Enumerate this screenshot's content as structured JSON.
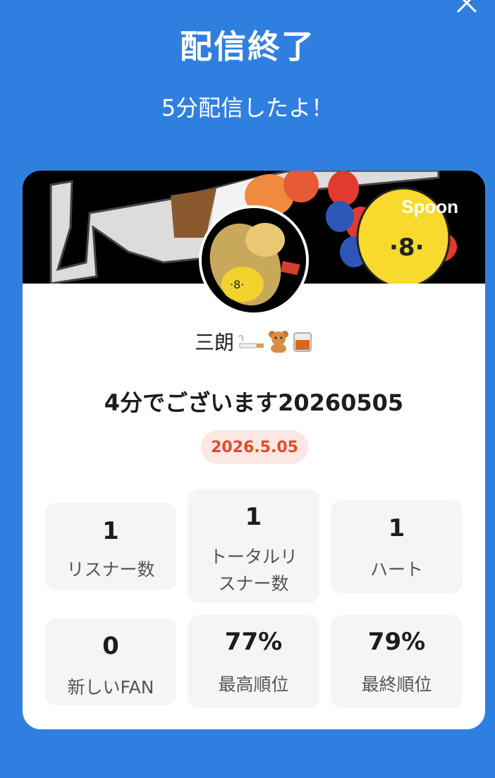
{
  "header": {
    "title": "配信終了",
    "subtitle": "5分配信したよ！"
  },
  "icons": {
    "close": "close-icon"
  },
  "card": {
    "brand": "Spoon",
    "username": "三朗",
    "username_emojis": [
      "cigarette-icon",
      "teddy-bear-icon",
      "whiskey-glass-icon"
    ],
    "live_title": "4分でございます20260505",
    "date": "2026.5.05"
  },
  "stats": {
    "listeners": {
      "value": "1",
      "label": "リスナー数"
    },
    "total_listeners": {
      "value": "1",
      "label_line1": "トータルリ",
      "label_line2": "スナー数"
    },
    "hearts": {
      "value": "1",
      "label": "ハート"
    },
    "new_fans": {
      "value": "0",
      "label": "新しいFAN"
    },
    "best_rank": {
      "value": "77%",
      "label": "最高順位"
    },
    "final_rank": {
      "value": "79%",
      "label": "最終順位"
    }
  },
  "colors": {
    "background": "#2f7fe0",
    "badge_bg": "#fde7e3",
    "badge_text": "#e14c28",
    "stat_bg": "#f5f5f5"
  }
}
